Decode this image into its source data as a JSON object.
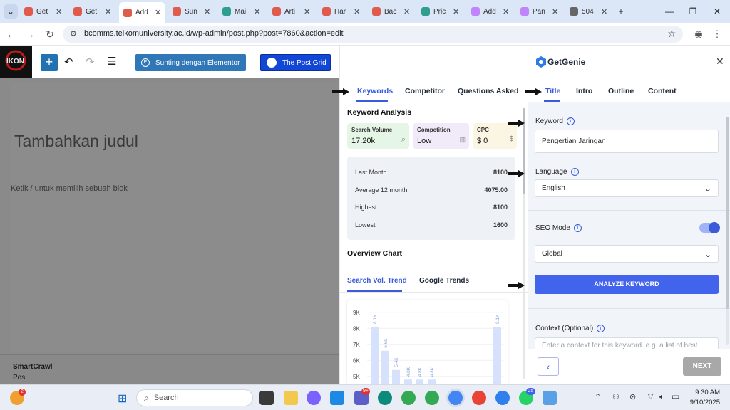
{
  "browser": {
    "tabs": [
      {
        "title": "Get",
        "color": "#e05b4b"
      },
      {
        "title": "Get",
        "color": "#e05b4b"
      },
      {
        "title": "Add",
        "color": "#e05b4b",
        "active": true
      },
      {
        "title": "Sun",
        "color": "#e05b4b"
      },
      {
        "title": "Mai",
        "color": "#2f9e8f"
      },
      {
        "title": "Arti",
        "color": "#e05b4b"
      },
      {
        "title": "Har",
        "color": "#e05b4b"
      },
      {
        "title": "Bac",
        "color": "#e05b4b"
      },
      {
        "title": "Pric",
        "color": "#2f9e8f"
      },
      {
        "title": "Add",
        "color": "#c084fc"
      },
      {
        "title": "Pan",
        "color": "#c084fc"
      },
      {
        "title": "504",
        "color": "#666666"
      }
    ],
    "new_tab": "+",
    "url": "bcomms.telkomuniversity.ac.id/wp-admin/post.php?post=7860&action=edit"
  },
  "wp": {
    "elementor_button": "Sunting dengan Elementor",
    "postgrid_button": "The Post Grid",
    "title_placeholder": "Tambahkan judul",
    "block_placeholder": "Ketik / untuk memilih sebuah blok",
    "footer_title": "SmartCrawl",
    "footer_sub": "Pos"
  },
  "keyword_panel": {
    "tabs": [
      "Keywords",
      "Competitor",
      "Questions Asked"
    ],
    "section_title": "Keyword Analysis",
    "metrics": [
      {
        "label": "Search Volume",
        "value": "17.20k",
        "bg": "#e6f6e6"
      },
      {
        "label": "Competition",
        "value": "Low",
        "bg": "#f1eaf9"
      },
      {
        "label": "CPC",
        "value": "$ 0",
        "bg": "#fbf5e3"
      }
    ],
    "stats": [
      {
        "label": "Last Month",
        "value": "8100"
      },
      {
        "label": "Average 12 month",
        "value": "4075.00"
      },
      {
        "label": "Highest",
        "value": "8100"
      },
      {
        "label": "Lowest",
        "value": "1600"
      }
    ],
    "overview_title": "Overview Chart",
    "chart_tabs": [
      "Search Vol. Trend",
      "Google Trends"
    ]
  },
  "chart_data": {
    "type": "bar",
    "yticks": [
      "9K",
      "8K",
      "7K",
      "6K",
      "5K"
    ],
    "ylim": [
      4500,
      9300
    ],
    "bars": [
      {
        "value": 8100,
        "label": "8.1K"
      },
      {
        "value": 6600,
        "label": "6.6K"
      },
      {
        "value": 5400,
        "label": "5.4K"
      },
      {
        "value": 4800,
        "label": "4.8K"
      },
      {
        "value": 4800,
        "label": "4.8K"
      },
      {
        "value": 4800,
        "label": "4.8K"
      },
      {
        "value": 8100,
        "label": "8.1K"
      }
    ]
  },
  "genie": {
    "brand": "GetGenie",
    "tabs": [
      "Title",
      "Intro",
      "Outline",
      "Content"
    ],
    "keyword_label": "Keyword",
    "keyword_value": "Pengertian Jaringan",
    "language_label": "Language",
    "language_value": "English",
    "seo_mode_label": "SEO Mode",
    "seo_mode_value": "Global",
    "analyze_button": "ANALYZE KEYWORD",
    "context_label": "Context (Optional)",
    "context_placeholder": "Enter a context for this keyword. e.g. a list of best",
    "next_button": "NEXT",
    "accent": "#4263eb"
  },
  "taskbar": {
    "search_placeholder": "Search",
    "time": "9:30 AM",
    "date": "9/10/2025",
    "badges": [
      "2",
      "9+",
      "25"
    ]
  }
}
